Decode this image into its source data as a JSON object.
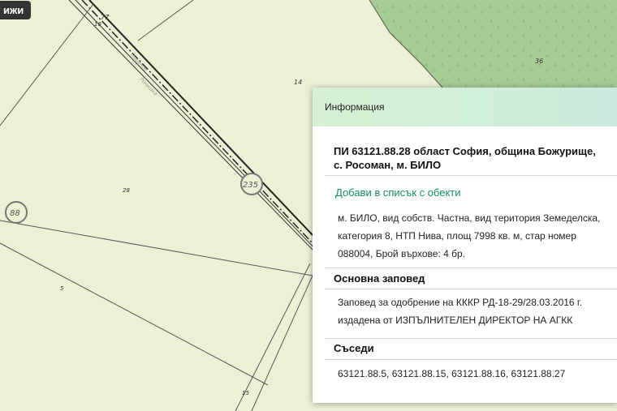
{
  "toolbar": {
    "button_label": "ижи"
  },
  "map": {
    "labels": {
      "l77": "77",
      "l16": "16",
      "l36": "36",
      "l14": "14",
      "l28": "28",
      "l5": "5",
      "l15": "15",
      "road_a": "Маринов",
      "road_b": "Ронишка"
    },
    "markers": {
      "m88": "88",
      "m235": "235"
    },
    "colors": {
      "land": "#eef0d6",
      "forest": "#a7cd94",
      "line": "#333333",
      "marker": "#777777"
    }
  },
  "info": {
    "header": "Информация",
    "title_line1": "ПИ 63121.88.28 област София, община Божурище,",
    "title_line2": "с. Росоман, м. БИЛО",
    "add_link": "Добави в списък с обекти",
    "desc_line1": "м. БИЛО, вид собств. Частна, вид територия Земеделска,",
    "desc_line2": "категория 8, НТП Нива, площ 7998 кв. м, стар номер",
    "desc_line3": "088004, Брой върхове: 4 бр.",
    "order_heading": "Основна заповед",
    "order_line1": "Заповед за одобрение на КККР РД-18-29/28.03.2016 г.",
    "order_line2": "издадена от ИЗПЪЛНИТЕЛЕН ДИРЕКТОР НА АГКК",
    "neighbors_heading": "Съседи",
    "neighbors": "63121.88.5, 63121.88.15, 63121.88.16, 63121.88.27"
  }
}
